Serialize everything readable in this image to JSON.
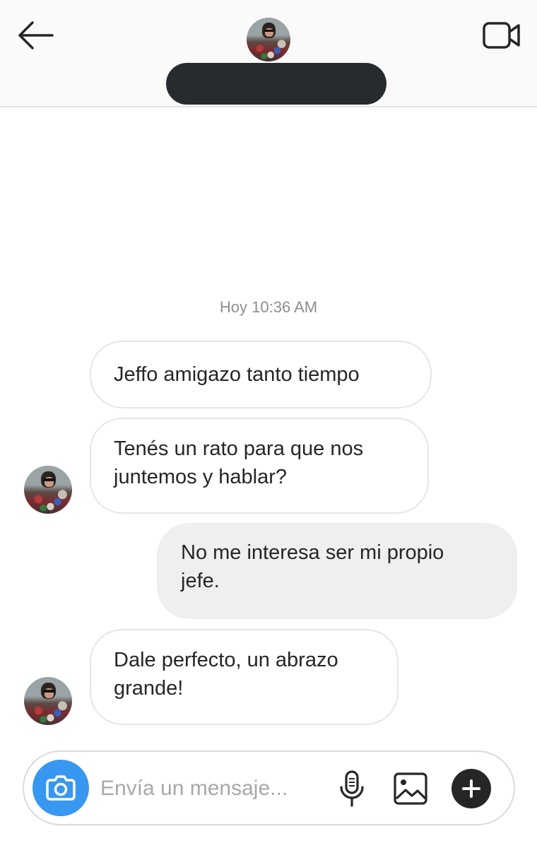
{
  "header": {
    "back_icon": "arrow-left-icon",
    "video_icon": "video-camera-icon",
    "contact_name": ""
  },
  "conversation": {
    "timestamp": "Hoy 10:36 AM",
    "messages": [
      {
        "direction": "incoming",
        "lines": [
          "Jeffo amigazo tanto tiempo"
        ]
      },
      {
        "direction": "incoming",
        "lines": [
          "Tenés un rato para que nos",
          "juntemos y hablar?"
        ]
      },
      {
        "direction": "outgoing",
        "lines": [
          "No me interesa ser mi propio",
          "jefe."
        ]
      },
      {
        "direction": "incoming",
        "lines": [
          "Dale perfecto, un abrazo",
          "grande!"
        ]
      }
    ]
  },
  "composer": {
    "placeholder": "Envía un mensaje...",
    "value": "",
    "camera_icon": "camera-icon",
    "mic_icon": "microphone-icon",
    "image_icon": "image-gallery-icon",
    "plus_icon": "plus-icon"
  },
  "colors": {
    "accent": "#3897f0",
    "header_bg": "#fafafa",
    "outgoing_bubble": "#efefef",
    "redaction": "#252b2e"
  }
}
